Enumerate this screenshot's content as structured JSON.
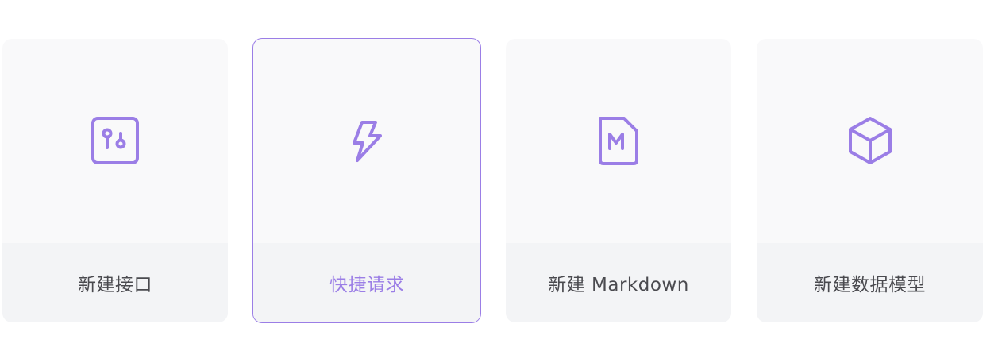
{
  "accent_color": "#9b7ee6",
  "cards": [
    {
      "label": "新建接口",
      "icon": "api-icon",
      "active": false
    },
    {
      "label": "快捷请求",
      "icon": "lightning-icon",
      "active": true
    },
    {
      "label": "新建 Markdown",
      "icon": "markdown-file-icon",
      "active": false
    },
    {
      "label": "新建数据模型",
      "icon": "cube-icon",
      "active": false
    }
  ]
}
